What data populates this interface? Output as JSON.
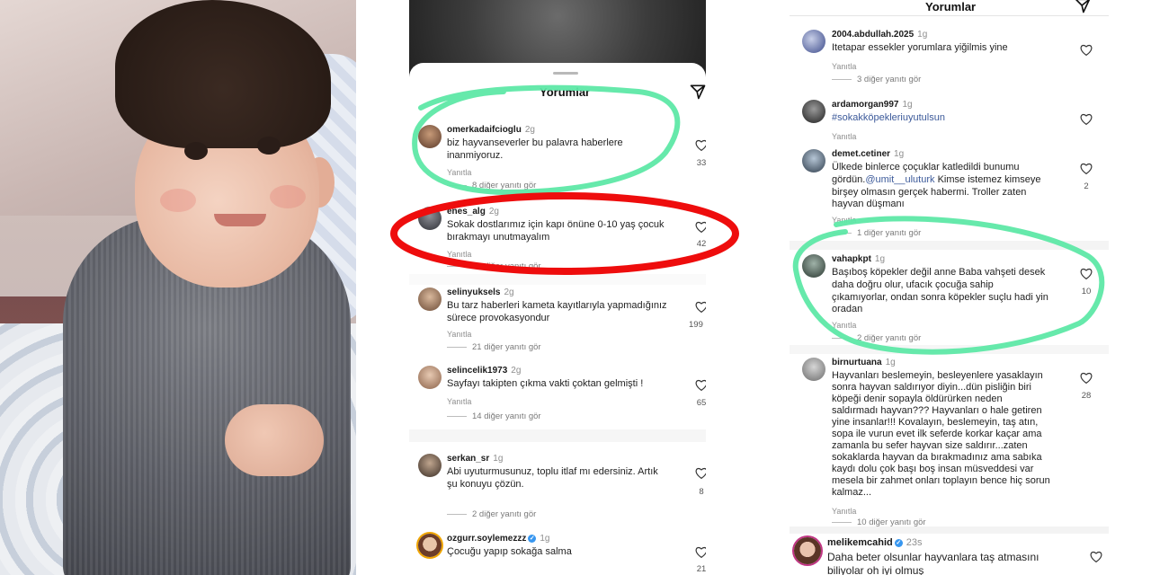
{
  "photo": {
    "alt": ""
  },
  "middle": {
    "title": "Yorumlar",
    "comments": [
      {
        "user": "omerkadaifcioglu",
        "time": "2g",
        "text_lines": [
          "biz hayvanseverler bu palavra haberlere",
          "inanmiyoruz."
        ],
        "reply": "Yanıtla",
        "more": "8 diğer yanıtı gör",
        "likes": "33"
      },
      {
        "user": "enes_alg",
        "time": "2g",
        "text_lines": [
          "Sokak dostlarımız için kapı önüne 0-10 yaş çocuk",
          "bırakmayı unutmayalım"
        ],
        "reply": "Yanıtla",
        "more": "12 diğer yanıtı gör",
        "likes": "42"
      },
      {
        "user": "selinyuksels",
        "time": "2g",
        "text_lines": [
          "Bu tarz haberleri kameta kayıtlarıyla yapmadığınız",
          "sürece provokasyondur"
        ],
        "reply": "Yanıtla",
        "more": "21 diğer yanıtı gör",
        "likes": "199"
      },
      {
        "user": "selincelik1973",
        "time": "2g",
        "text_lines": [
          "Sayfayı takipten çıkma vakti çoktan gelmişti !"
        ],
        "reply": "Yanıtla",
        "more": "14 diğer yanıtı gör",
        "likes": "65"
      },
      {
        "user": "serkan_sr",
        "time": "1g",
        "text_lines": [
          "Abi uyuturmusunuz, toplu itlaf mı edersiniz. Artık",
          "şu konuyu çözün."
        ],
        "reply": "",
        "more": "2 diğer yanıtı gör",
        "likes": "8"
      },
      {
        "user": "ozgurr.soylemezzz",
        "time": "1g",
        "text_lines": [
          "Çocuğu yapıp sokağa salma"
        ],
        "reply": "",
        "more": "",
        "likes": "21"
      }
    ]
  },
  "right": {
    "title": "Yorumlar",
    "comments": [
      {
        "user": "2004.abdullah.2025",
        "time": "1g",
        "text_lines": [
          "Itetapar essekler yorumlara yiğilmis yine"
        ],
        "reply": "Yanıtla",
        "more": "3 diğer yanıtı gör",
        "likes": ""
      },
      {
        "user": "ardamorgan997",
        "time": "1g",
        "text_lines": [
          "#sokakköpekleriuyutulsun"
        ],
        "reply": "Yanıtla",
        "more": "",
        "likes": ""
      },
      {
        "user": "demet.cetiner",
        "time": "1g",
        "text_lines": [
          "Ülkede binlerce çoçuklar katledildi bunumu",
          "gördün.@umit__uluturk Kimse istemez kimseye",
          "birşey olmasın gerçek habermi. Troller zaten",
          "hayvan düşmanı"
        ],
        "reply": "Yanıtla",
        "more": "1 diğer yanıtı gör",
        "likes": "2"
      },
      {
        "user": "vahapkpt",
        "time": "1g",
        "text_lines": [
          "Başıboş köpekler değil anne Baba vahşeti desek",
          "daha doğru olur, ufacık çocuğa sahip",
          "çıkamıyorlar, ondan sonra köpekler suçlu hadi yin",
          "oradan"
        ],
        "reply": "Yanıtla",
        "more": "2 diğer yanıtı gör",
        "likes": "10"
      },
      {
        "user": "birnurtuana",
        "time": "1g",
        "text_lines": [
          "Hayvanları beslemeyin, besleyenlere yasaklayın",
          "sonra hayvan saldırıyor diyin...dün pisliğin biri",
          "köpeği denir sopayla öldürürken neden",
          "saldırmadı hayvan??? Hayvanları o hale getiren",
          "yine insanlar!!! Kovalayın, beslemeyin, taş atın,",
          "sopa ile vurun evet ilk seferde korkar kaçar ama",
          "zamanla bu sefer hayvan size saldırır...zaten",
          "sokaklarda hayvan da bırakmadınız ama sabıka",
          "kaydı dolu çok başı boş insan müsveddesi var",
          "mesela bir zahmet onları toplayın bence hiç sorun",
          "kalmaz..."
        ],
        "reply": "Yanıtla",
        "more": "10 diğer yanıtı gör",
        "likes": "28"
      },
      {
        "user": "melikemcahid",
        "time": "23s",
        "text_lines": [
          "Daha beter olsunlar hayvanlara taş atmasını",
          "biliyolar oh iyi olmuş"
        ],
        "reply": "",
        "more": "",
        "likes": ""
      }
    ]
  },
  "colors": {
    "highlight_green": "#5ee8a6",
    "highlight_red": "#ee0d0d",
    "username": "#1a1a1a",
    "muted": "#8e8e8e",
    "mention": "#3c5a9a"
  },
  "icons": {
    "send": "send-icon",
    "heart": "heart-icon",
    "verified": "verified-badge-icon"
  }
}
